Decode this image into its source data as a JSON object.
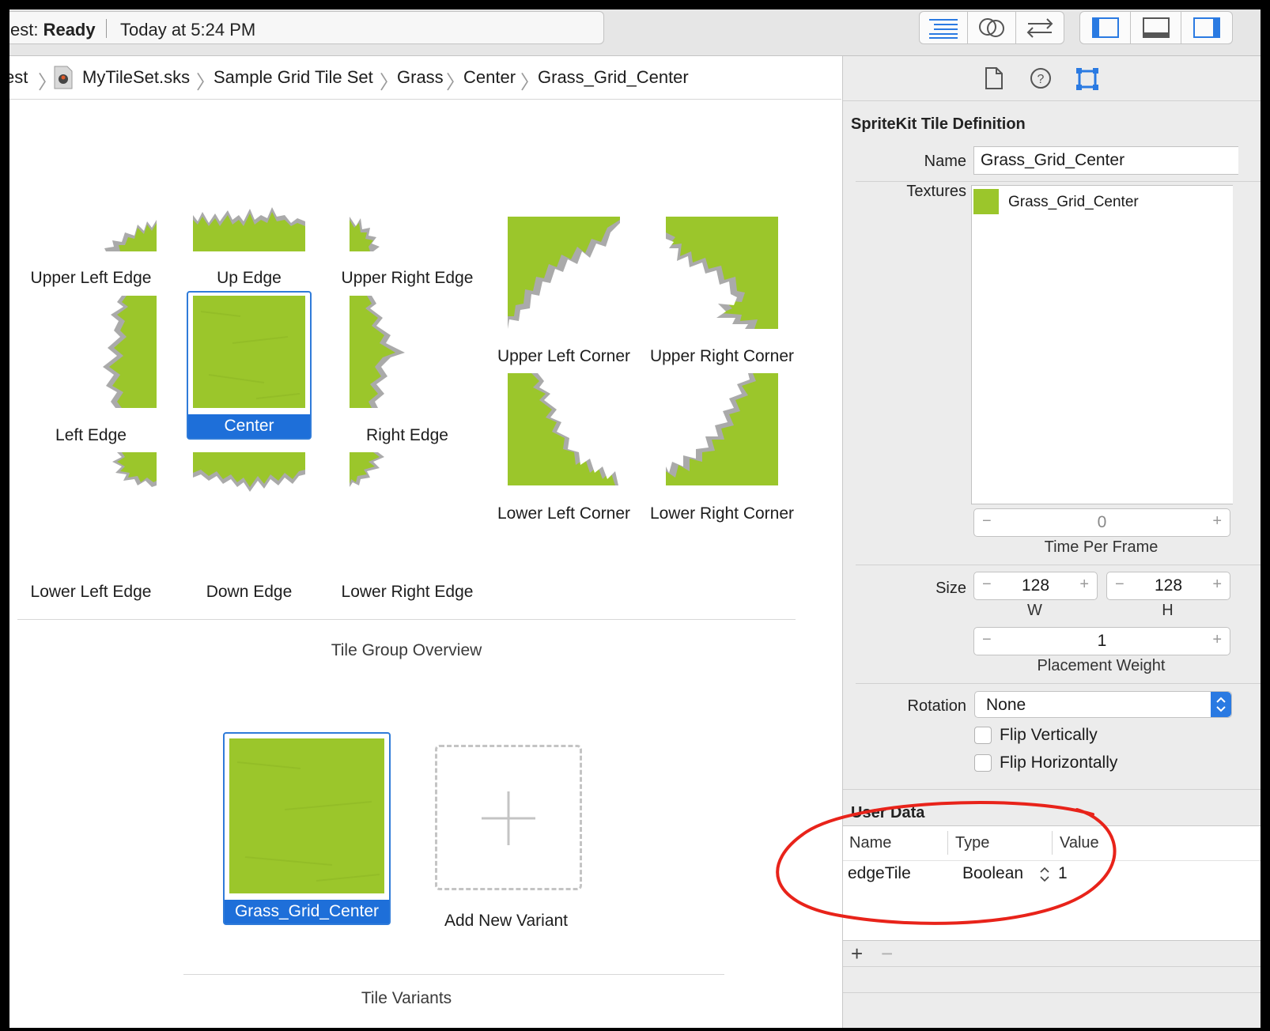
{
  "toolbar": {
    "status_prefix": "est: ",
    "status": "Ready",
    "time": "Today at 5:24 PM"
  },
  "breadcrumb": [
    "est",
    "MyTileSet.sks",
    "Sample Grid Tile Set",
    "Grass",
    "Center",
    "Grass_Grid_Center"
  ],
  "tiles": {
    "upper_left_edge": "Upper Left Edge",
    "up_edge": "Up Edge",
    "upper_right_edge": "Upper Right Edge",
    "left_edge": "Left Edge",
    "center": "Center",
    "right_edge": "Right Edge",
    "lower_left_edge": "Lower Left Edge",
    "down_edge": "Down Edge",
    "lower_right_edge": "Lower Right Edge",
    "upper_left_corner": "Upper Left Corner",
    "upper_right_corner": "Upper Right Corner",
    "lower_left_corner": "Lower Left Corner",
    "lower_right_corner": "Lower Right Corner"
  },
  "overview_title": "Tile Group Overview",
  "variants": {
    "selected_label": "Grass_Grid_Center",
    "add_label": "Add New Variant",
    "title": "Tile Variants"
  },
  "inspector": {
    "title": "SpriteKit Tile Definition",
    "name_label": "Name",
    "name_value": "Grass_Grid_Center",
    "textures_label": "Textures",
    "texture_item": "Grass_Grid_Center",
    "time_per_frame_value": "0",
    "time_per_frame_label": "Time Per Frame",
    "size_label": "Size",
    "width_value": "128",
    "width_label": "W",
    "height_value": "128",
    "height_label": "H",
    "placement_weight_value": "1",
    "placement_weight_label": "Placement Weight",
    "rotation_label": "Rotation",
    "rotation_value": "None",
    "flip_vertical": "Flip Vertically",
    "flip_horizontal": "Flip Horizontally"
  },
  "user_data": {
    "title": "User Data",
    "columns": [
      "Name",
      "Type",
      "Value"
    ],
    "row": {
      "name": "edgeTile",
      "type": "Boolean",
      "value": "1"
    }
  },
  "colors": {
    "accent": "#1e6fd9",
    "grass": "#9bc62b",
    "annotation": "#e8231a"
  }
}
